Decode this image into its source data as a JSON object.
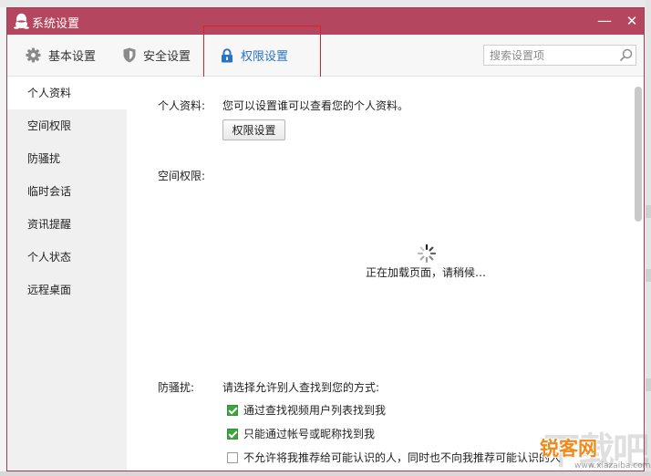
{
  "window": {
    "title": "系统设置",
    "minimize_glyph": "—",
    "close_glyph": "✕"
  },
  "tabs": [
    {
      "label": "基本设置",
      "icon": "gear-icon"
    },
    {
      "label": "安全设置",
      "icon": "shield-icon"
    },
    {
      "label": "权限设置",
      "icon": "lock-icon",
      "active": true
    }
  ],
  "search": {
    "placeholder": "搜索设置项"
  },
  "sidebar": {
    "items": [
      {
        "label": "个人资料",
        "active": true
      },
      {
        "label": "空间权限"
      },
      {
        "label": "防骚扰"
      },
      {
        "label": "临时会话"
      },
      {
        "label": "资讯提醒"
      },
      {
        "label": "个人状态"
      },
      {
        "label": "远程桌面"
      }
    ]
  },
  "content": {
    "profile": {
      "label": "个人资料:",
      "description": "您可以设置谁可以查看您的个人资料。",
      "button": "权限设置"
    },
    "space": {
      "label": "空间权限:",
      "loading": "正在加载页面，请稍候…"
    },
    "harass": {
      "label": "防骚扰:",
      "description": "请选择允许别人查找到您的方式:",
      "options": [
        {
          "label": "通过查找视频用户列表找到我",
          "checked": true
        },
        {
          "label": "只能通过帐号或昵称找到我",
          "checked": true
        },
        {
          "label": "不允许将我推荐给可能认识的人，同时也不向我推荐可能认识的人",
          "checked": false
        }
      ]
    }
  },
  "watermark": {
    "brand": "锐客网",
    "back": "下载吧",
    "url": "www.xiazaiba.com"
  },
  "colors": {
    "titlebar": "#b5465f",
    "accent": "#2a72c8",
    "checkbox": "#3fa43f",
    "highlight": "#e31e1e"
  }
}
